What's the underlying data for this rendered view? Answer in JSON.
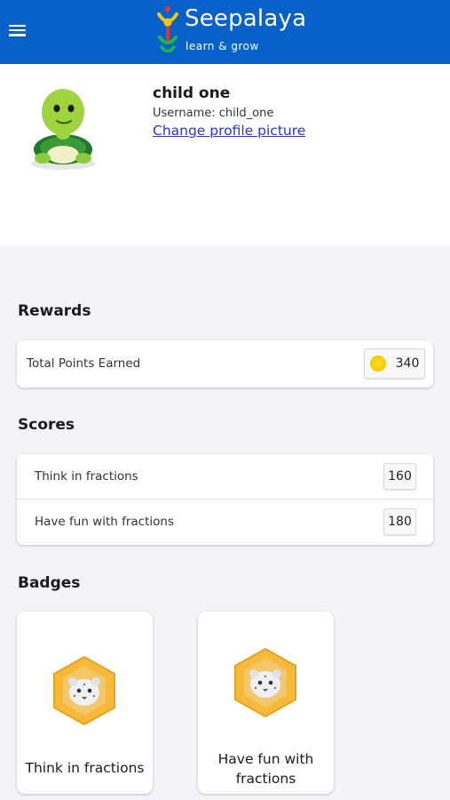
{
  "header": {
    "brand": "Seepalaya",
    "tagline": "learn & grow",
    "bg_color": "#0662c8",
    "menu_icon": "hamburger-icon"
  },
  "profile": {
    "name": "child one",
    "username_line": "Username: child_one",
    "change_picture_link": "Change profile picture",
    "avatar_icon": "turtle-avatar"
  },
  "rewards": {
    "title": "Rewards",
    "total_label": "Total Points Earned",
    "total_points": "340",
    "coin_icon": "coin-icon"
  },
  "scores": {
    "title": "Scores",
    "items": [
      {
        "label": "Think in fractions",
        "score": "160"
      },
      {
        "label": "Have fun with fractions",
        "score": "180"
      }
    ]
  },
  "badges": {
    "title": "Badges",
    "items": [
      {
        "label": "Think in fractions",
        "icon": "snow-leopard-badge-icon"
      },
      {
        "label": "Have fun with fractions",
        "icon": "snow-leopard-badge-icon"
      }
    ]
  }
}
